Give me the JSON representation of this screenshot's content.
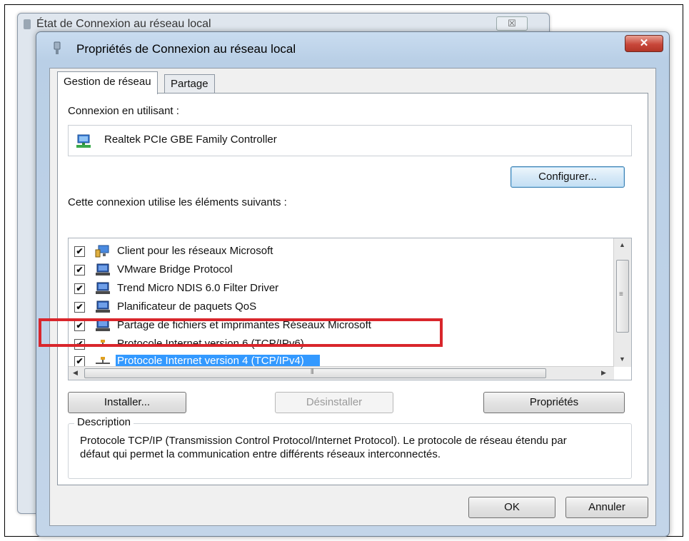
{
  "background_window": {
    "title": "État de Connexion au réseau local",
    "close_glyph": "☒"
  },
  "dialog": {
    "title": "Propriétés de Connexion au réseau local",
    "close_glyph": "✕"
  },
  "tabs": [
    {
      "label": "Gestion de réseau",
      "active": true
    },
    {
      "label": "Partage",
      "active": false
    }
  ],
  "connect_using": {
    "label": "Connexion en utilisant :",
    "adapter": "Realtek PCIe GBE Family Controller",
    "configure_button": "Configurer..."
  },
  "items_section": {
    "label": "Cette connexion utilise les éléments suivants :",
    "items": [
      {
        "label": "Client pour les réseaux Microsoft",
        "checked": true,
        "icon": "network-client-icon"
      },
      {
        "label": "VMware Bridge Protocol",
        "checked": true,
        "icon": "network-service-icon"
      },
      {
        "label": "Trend Micro NDIS 6.0 Filter Driver",
        "checked": true,
        "icon": "network-service-icon"
      },
      {
        "label": "Planificateur de paquets QoS",
        "checked": true,
        "icon": "network-service-icon"
      },
      {
        "label": "Partage de fichiers et imprimantes Réseaux Microsoft",
        "checked": true,
        "icon": "network-service-icon"
      },
      {
        "label": "Protocole Internet version 6 (TCP/IPv6)",
        "checked": true,
        "icon": "protocol-icon"
      },
      {
        "label": "Protocole Internet version 4 (TCP/IPv4)",
        "checked": true,
        "icon": "protocol-icon",
        "selected": true
      }
    ],
    "check_glyph": "✔"
  },
  "actions": {
    "install": "Installer...",
    "uninstall": "Désinstaller",
    "properties": "Propriétés"
  },
  "description": {
    "legend": "Description",
    "text": "Protocole TCP/IP (Transmission Control Protocol/Internet Protocol). Le protocole de réseau étendu par défaut qui permet la communication entre différents réseaux interconnectés."
  },
  "footer": {
    "ok": "OK",
    "cancel": "Annuler"
  },
  "colors": {
    "selection": "#3399ff",
    "highlight_box": "#d9262c",
    "close_button": "#c8473a"
  }
}
